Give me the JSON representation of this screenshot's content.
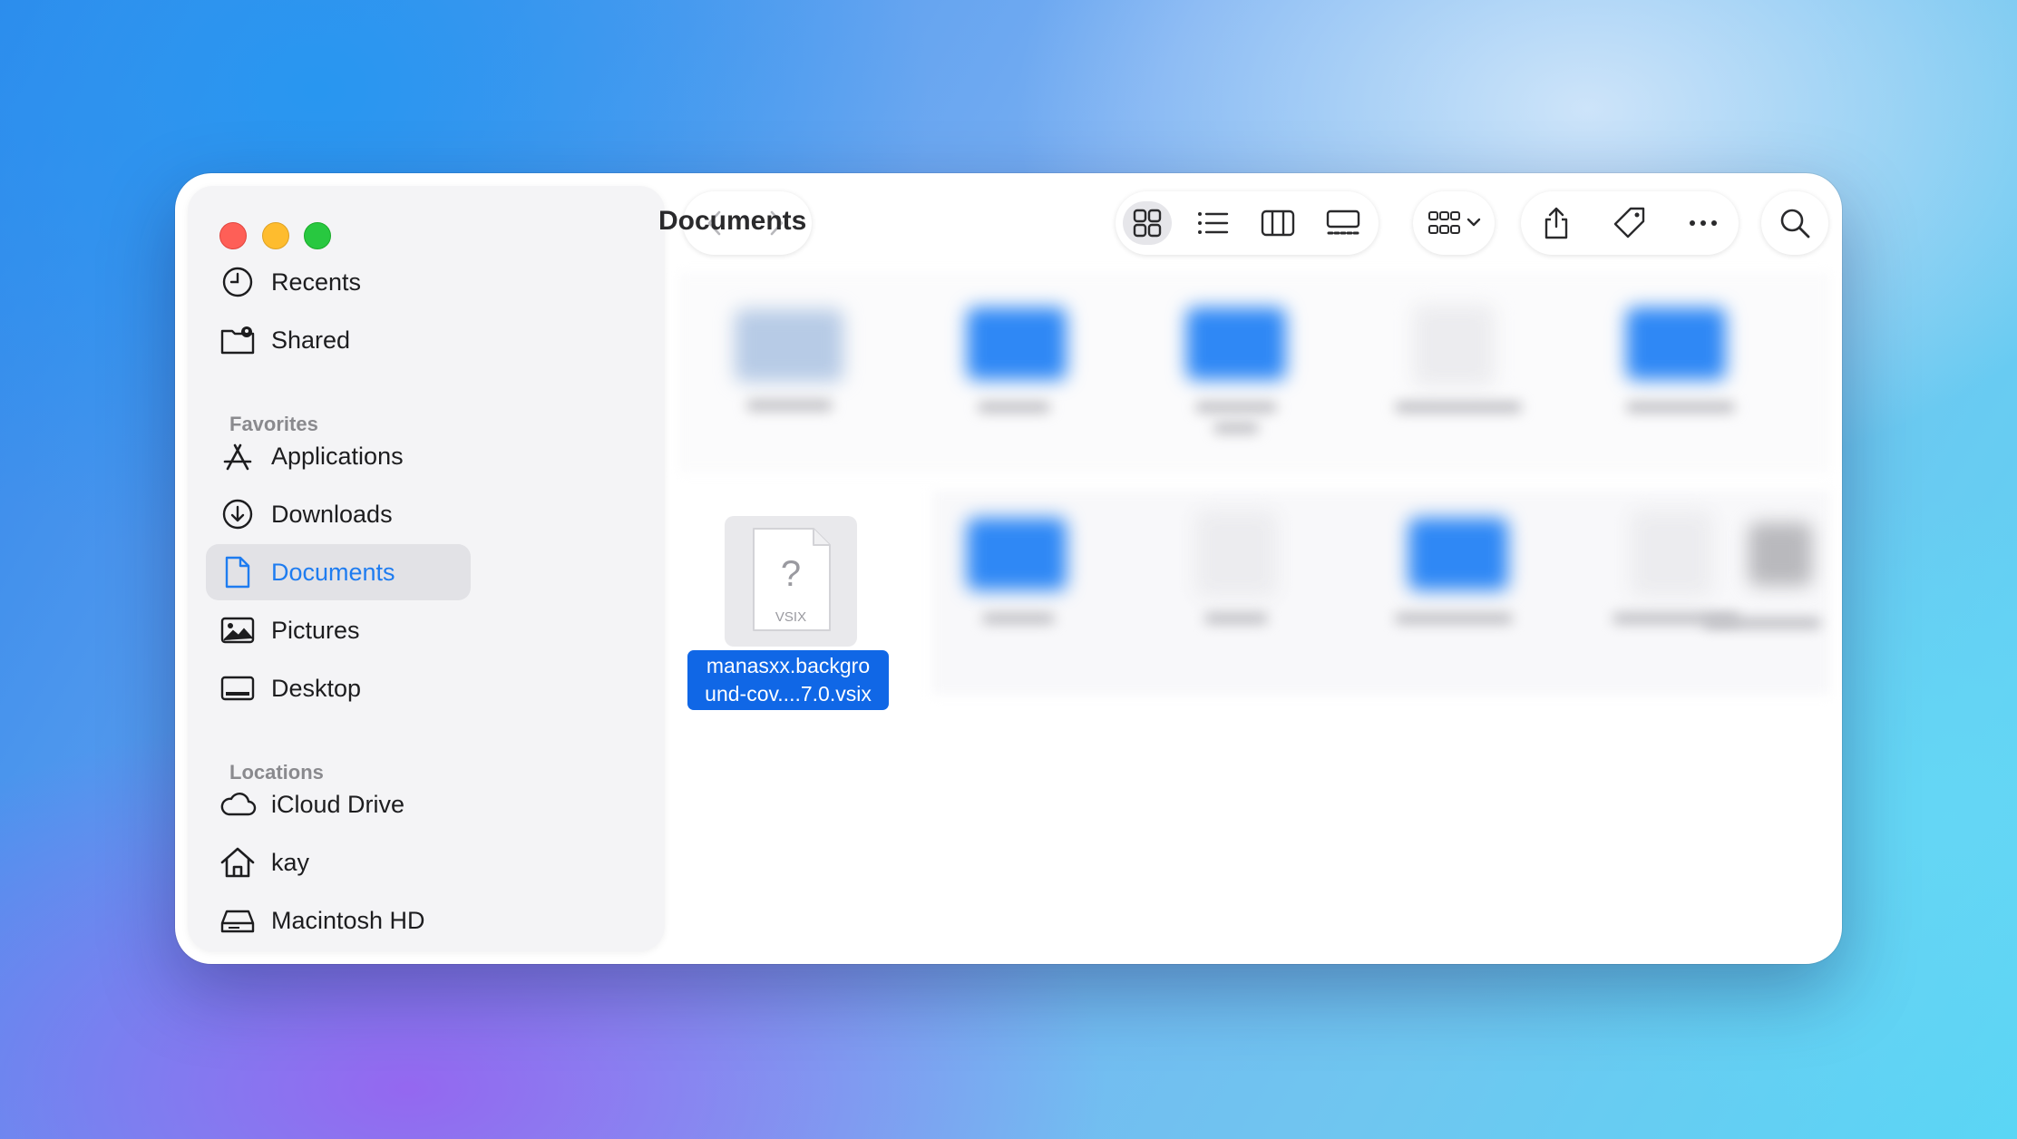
{
  "window": {
    "title": "Documents"
  },
  "sidebar": {
    "top_items": [
      {
        "label": "Recents",
        "icon": "clock-icon"
      },
      {
        "label": "Shared",
        "icon": "shared-folder-icon"
      }
    ],
    "favorites_header": "Favorites",
    "favorites": [
      {
        "label": "Applications",
        "icon": "applications-icon"
      },
      {
        "label": "Downloads",
        "icon": "download-icon"
      },
      {
        "label": "Documents",
        "icon": "document-icon",
        "active": true
      },
      {
        "label": "Pictures",
        "icon": "photo-icon"
      },
      {
        "label": "Desktop",
        "icon": "desktop-icon"
      }
    ],
    "locations_header": "Locations",
    "locations": [
      {
        "label": "iCloud Drive",
        "icon": "cloud-icon"
      },
      {
        "label": "kay",
        "icon": "home-icon"
      },
      {
        "label": "Macintosh HD",
        "icon": "disk-icon"
      }
    ]
  },
  "toolbar": {
    "view_modes": [
      "icon-view",
      "list-view",
      "column-view",
      "gallery-view"
    ],
    "selected_view": "icon-view"
  },
  "selected_file": {
    "name_line1": "manasxx.backgro",
    "name_line2": "und-cov....7.0.vsix",
    "type_badge": "VSIX",
    "icon_glyph": "?"
  },
  "colors": {
    "accent": "#1067e6",
    "sidebar_active_text": "#1e7cf0",
    "folder_blue": "#2f88f5"
  }
}
